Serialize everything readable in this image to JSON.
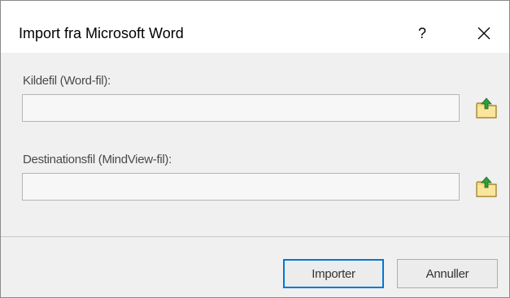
{
  "window": {
    "title": "Import fra Microsoft Word",
    "help_label": "?"
  },
  "source": {
    "label": "Kildefil (Word-fil):",
    "value": "",
    "browse_icon": "folder-open-icon"
  },
  "destination": {
    "label": "Destinationsfil (MindView-fil):",
    "value": "",
    "browse_icon": "folder-open-icon"
  },
  "buttons": {
    "import_label": "Importer",
    "cancel_label": "Annuller"
  },
  "colors": {
    "focus_border": "#0078d7",
    "folder_fill": "#f5d97a",
    "arrow_fill": "#2e9e3a"
  }
}
